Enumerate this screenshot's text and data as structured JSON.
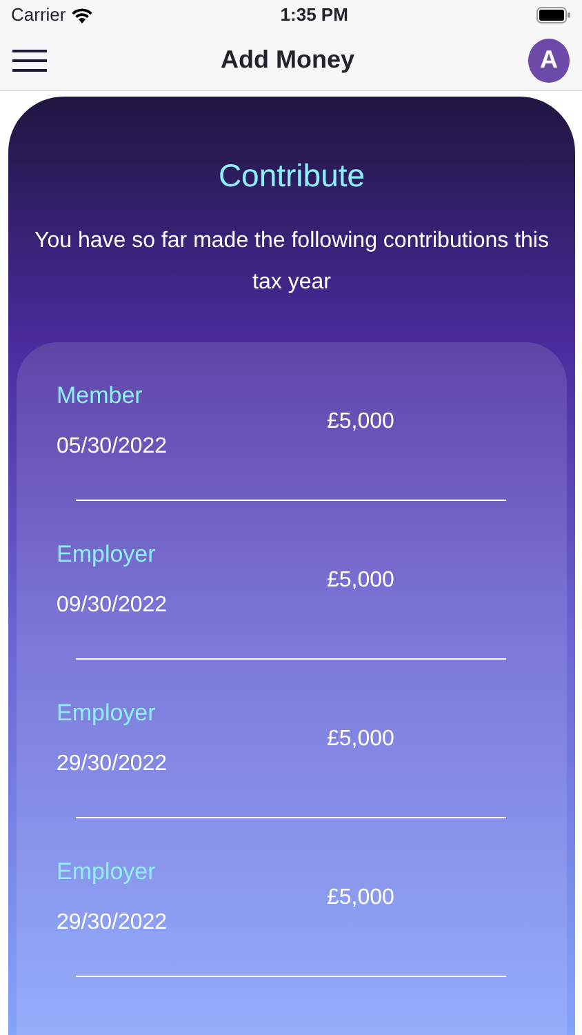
{
  "status_bar": {
    "carrier": "Carrier",
    "time": "1:35 PM"
  },
  "nav_bar": {
    "title": "Add Money",
    "avatar": "A"
  },
  "heading": "Contribute",
  "intro": "You have so far made the following contributions this tax year",
  "contributions": [
    {
      "type": "Member",
      "date": "05/30/2022",
      "amount": "£5,000"
    },
    {
      "type": "Employer",
      "date": "09/30/2022",
      "amount": "£5,000"
    },
    {
      "type": "Employer",
      "date": "29/30/2022",
      "amount": "£5,000"
    },
    {
      "type": "Employer",
      "date": "29/30/2022",
      "amount": "£5,000"
    }
  ]
}
